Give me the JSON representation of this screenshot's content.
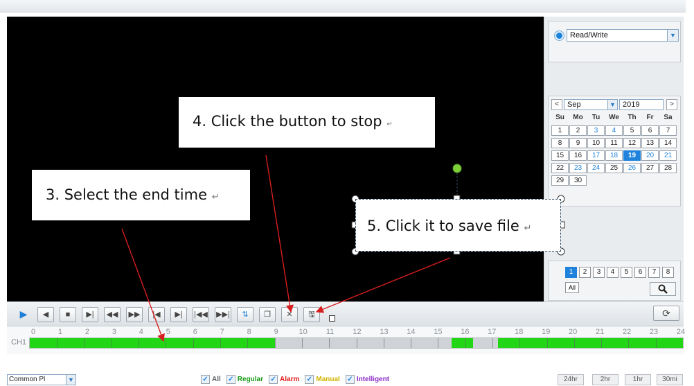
{
  "right_panel": {
    "mode_select": "Read/Write",
    "calendar": {
      "month": "Sep",
      "year": "2019",
      "weekdays": [
        "Su",
        "Mo",
        "Tu",
        "We",
        "Th",
        "Fr",
        "Sa"
      ],
      "weeks": [
        [
          {
            "d": "1"
          },
          {
            "d": "2"
          },
          {
            "d": "3",
            "rec": true
          },
          {
            "d": "4",
            "rec": true
          },
          {
            "d": "5"
          },
          {
            "d": "6"
          },
          {
            "d": "7"
          }
        ],
        [
          {
            "d": "8"
          },
          {
            "d": "9"
          },
          {
            "d": "10"
          },
          {
            "d": "11"
          },
          {
            "d": "12"
          },
          {
            "d": "13"
          },
          {
            "d": "14"
          }
        ],
        [
          {
            "d": "15"
          },
          {
            "d": "16"
          },
          {
            "d": "17",
            "rec": true
          },
          {
            "d": "18",
            "rec": true
          },
          {
            "d": "19",
            "sel": true
          },
          {
            "d": "20",
            "rec": true
          },
          {
            "d": "21",
            "rec": true
          }
        ],
        [
          {
            "d": "22"
          },
          {
            "d": "23",
            "rec": true
          },
          {
            "d": "24",
            "rec": true
          },
          {
            "d": "25"
          },
          {
            "d": "26",
            "rec": true
          },
          {
            "d": "27"
          },
          {
            "d": "28"
          }
        ],
        [
          {
            "d": "29"
          },
          {
            "d": "30"
          }
        ]
      ],
      "prev_label": "<",
      "next_label": ">"
    },
    "channels": [
      "1",
      "2",
      "3",
      "4",
      "5",
      "6",
      "7",
      "8"
    ],
    "selected_channel": "1",
    "all_label": "All",
    "search_icon": "magnifier-icon"
  },
  "controls": {
    "buttons": [
      {
        "name": "play-button",
        "glyph": "▶"
      },
      {
        "name": "reverse-button",
        "glyph": "◀"
      },
      {
        "name": "stop-button",
        "glyph": "■"
      },
      {
        "name": "step-forward-button",
        "glyph": "▶|"
      },
      {
        "name": "slow-button",
        "glyph": "◀◀"
      },
      {
        "name": "fast-button",
        "glyph": "▶▶"
      },
      {
        "name": "prev-frame-button",
        "glyph": "|◀"
      },
      {
        "name": "next-frame-button",
        "glyph": "▶|"
      },
      {
        "name": "prev-file-button",
        "glyph": "|◀◀"
      },
      {
        "name": "next-file-button",
        "glyph": "▶▶|"
      },
      {
        "name": "sync-button",
        "glyph": "⇅"
      },
      {
        "name": "window-button",
        "glyph": "❐"
      },
      {
        "name": "clip-button",
        "glyph": "✕"
      },
      {
        "name": "save-file-button",
        "glyph": "🖫"
      }
    ],
    "refresh_icon": "refresh-icon"
  },
  "timeline": {
    "channel_label": "CH1",
    "ticks": [
      "0",
      "1",
      "2",
      "3",
      "4",
      "5",
      "6",
      "7",
      "8",
      "9",
      "10",
      "11",
      "12",
      "13",
      "14",
      "15",
      "16",
      "17",
      "18",
      "19",
      "20",
      "21",
      "22",
      "23",
      "24"
    ],
    "recorded_segments": [
      [
        0,
        9
      ],
      [
        15.5,
        16.3
      ],
      [
        17.2,
        24
      ]
    ],
    "hour_min": 0,
    "hour_max": 24
  },
  "bottom": {
    "playback_mode": "Common Pl",
    "legend": [
      {
        "label": "All",
        "color": "#5a5f66"
      },
      {
        "label": "Regular",
        "color": "#159b15"
      },
      {
        "label": "Alarm",
        "color": "#e01818"
      },
      {
        "label": "Manual",
        "color": "#d1b300"
      },
      {
        "label": "Intelligent",
        "color": "#8c2cc8"
      }
    ],
    "zoom_levels": [
      "24hr",
      "2hr",
      "1hr",
      "30mi"
    ]
  },
  "annotations": {
    "stop": "4. Click the button to stop",
    "end_time": "3. Select the end time",
    "save": "5. Click it to save file",
    "return_mark": "↵"
  }
}
